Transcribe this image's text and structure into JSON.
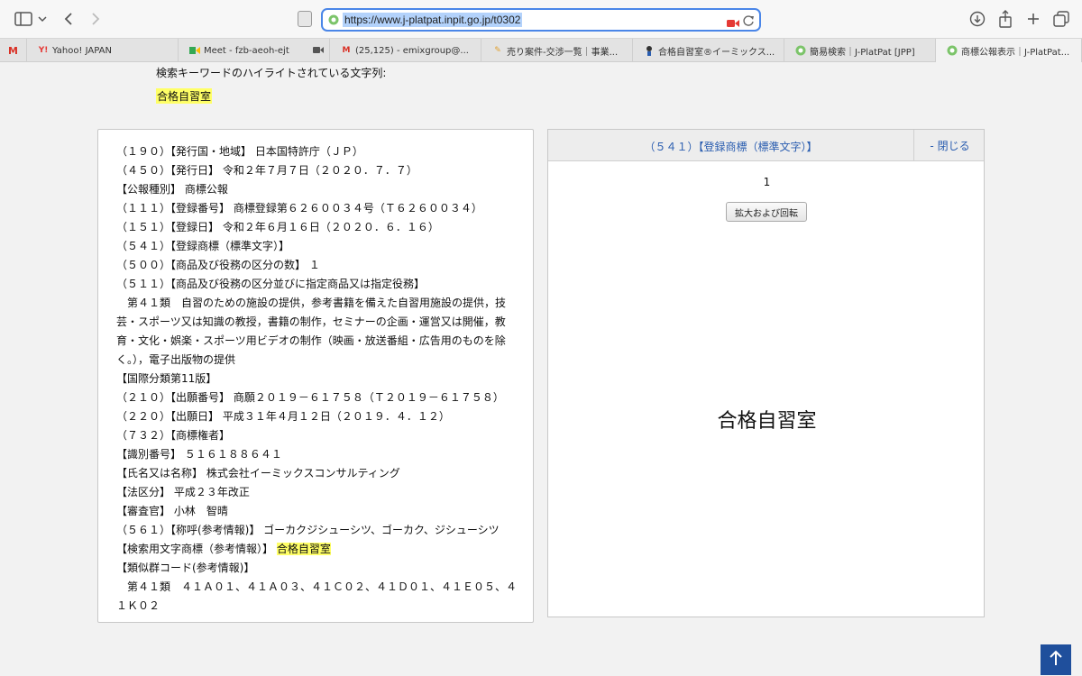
{
  "browser": {
    "url": "https://www.j-platpat.inpit.go.jp/t0302",
    "tabs": [
      {
        "label": "Yahoo! JAPAN"
      },
      {
        "label": "Meet - fzb-aeoh-ejt"
      },
      {
        "label": "(25,125) - emixgroup@..."
      },
      {
        "label": "売り案件-交渉一覧｜事業..."
      },
      {
        "label": "合格自習室®イーミックス..."
      },
      {
        "label": "簡易検索｜J-PlatPat [JPP]"
      },
      {
        "label": "商標公報表示｜J-PlatPat..."
      }
    ]
  },
  "keyword": {
    "label": "検索キーワードのハイライトされている文字列:",
    "value": "合格自習室"
  },
  "gazette": {
    "l01": "（１９０）【発行国・地域】 日本国特許庁（ＪＰ）",
    "l02": "（４５０）【発行日】 令和２年７月７日（２０２０．７．７）",
    "l03": "【公報種別】 商標公報",
    "l04": "（１１１）【登録番号】 商標登録第６２６００３４号（Ｔ６２６００３４）",
    "l05": "（１５１）【登録日】 令和２年６月１６日（２０２０．６．１６）",
    "l06": "（５４１）【登録商標（標準文字）】",
    "l07": "（５００）【商品及び役務の区分の数】 １",
    "l08": "（５１１）【商品及び役務の区分並びに指定商品又は指定役務】",
    "l09": "　第４１類　自習のための施設の提供，参考書籍を備えた自習用施設の提供，技芸・スポーツ又は知識の教授，書籍の制作，セミナーの企画・運営又は開催，教育・文化・娯楽・スポーツ用ビデオの制作（映画・放送番組・広告用のものを除く。），電子出版物の提供",
    "l10": "【国際分類第11版】",
    "l11": "（２１０）【出願番号】 商願２０１９－６１７５８（Ｔ２０１９－６１７５８）",
    "l12": "（２２０）【出願日】 平成３１年４月１２日（２０１９．４．１２）",
    "l13": "（７３２）【商標権者】",
    "l14": "【識別番号】 ５１６１８８６４１",
    "l15": "【氏名又は名称】 株式会社イーミックスコンサルティング",
    "l16": "【法区分】 平成２３年改正",
    "l17": "【審査官】 小林　智晴",
    "l18": "（５６１）【称呼(参考情報)】 ゴーカクジシューシツ、ゴーカク、ジシューシツ",
    "l19_label": "【検索用文字商標（参考情報）】",
    "l19_value": "合格自習室",
    "l20": "【類似群コード(参考情報)】",
    "l21": "　第４１類　４１Ａ０１、４１Ａ０３、４１Ｃ０２、４１Ｄ０１、４１Ｅ０５、４１Ｋ０２"
  },
  "mark_panel": {
    "title": "（５４１）【登録商標（標準文字）】",
    "close": "- 閉じる",
    "page": "1",
    "zoom_button": "拡大および回転",
    "mark_text": "合格自習室"
  },
  "icons": {
    "scroll_top": "arrow-up-icon",
    "color_accent": "#4a86e8",
    "color_highlight": "#ffff66",
    "color_link": "#2a5db0"
  }
}
